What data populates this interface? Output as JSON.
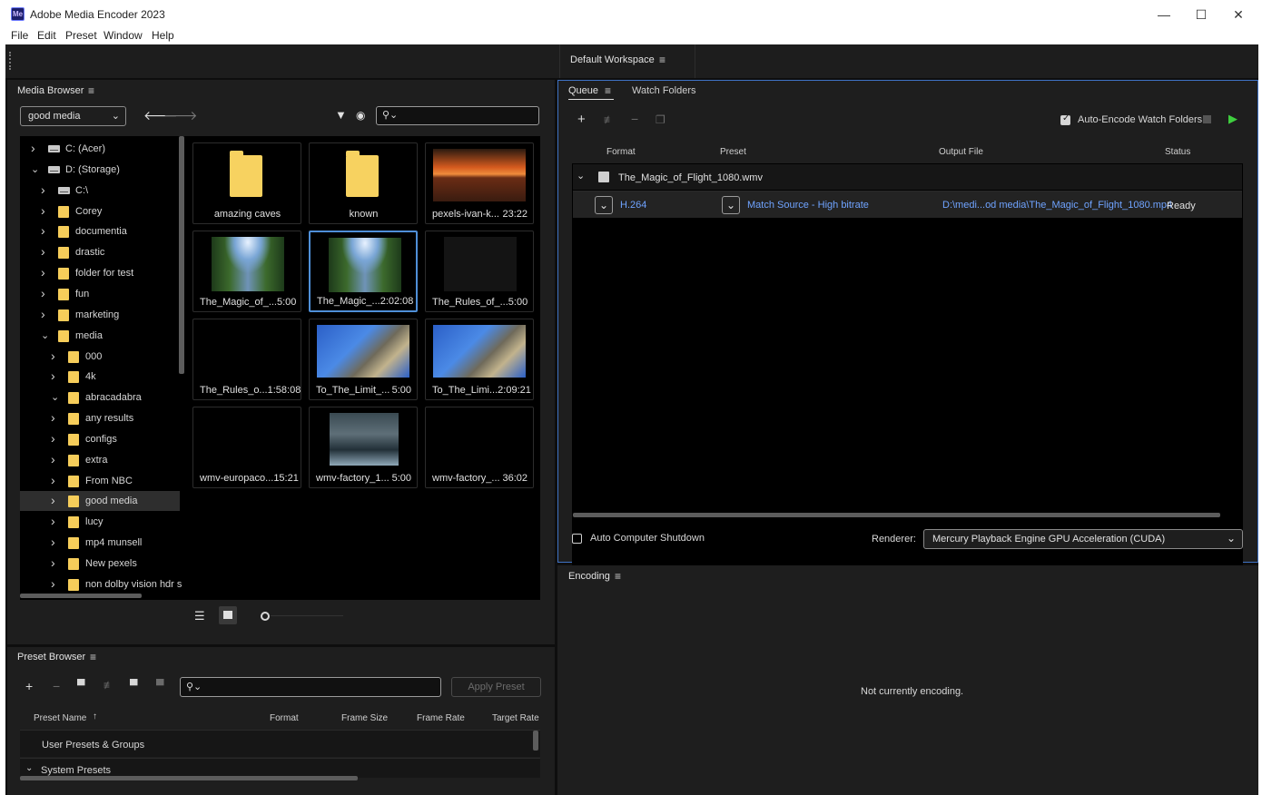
{
  "window": {
    "title": "Adobe Media Encoder 2023",
    "logo": "Me",
    "minimize": "—",
    "maximize": "☐",
    "close": "✕"
  },
  "menu": [
    "File",
    "Edit",
    "Preset",
    "Window",
    "Help"
  ],
  "workspace": {
    "label": "Default Workspace"
  },
  "media_browser": {
    "title": "Media Browser",
    "location": "good media",
    "search_placeholder": "",
    "tree": [
      {
        "label": "C: (Acer)",
        "type": "drive",
        "level": 0,
        "expanded": false
      },
      {
        "label": "D: (Storage)",
        "type": "drive",
        "level": 0,
        "expanded": true
      },
      {
        "label": "C:\\",
        "type": "drive",
        "level": 1,
        "expanded": false
      },
      {
        "label": "Corey",
        "type": "folder",
        "level": 1,
        "expanded": false
      },
      {
        "label": "documentia",
        "type": "folder",
        "level": 1,
        "expanded": false
      },
      {
        "label": "drastic",
        "type": "folder",
        "level": 1,
        "expanded": false
      },
      {
        "label": "folder for test",
        "type": "folder",
        "level": 1,
        "expanded": false
      },
      {
        "label": "fun",
        "type": "folder",
        "level": 1,
        "expanded": false
      },
      {
        "label": "marketing",
        "type": "folder",
        "level": 1,
        "expanded": false
      },
      {
        "label": "media",
        "type": "folder",
        "level": 1,
        "expanded": true
      },
      {
        "label": "000",
        "type": "folder",
        "level": 2,
        "expanded": false
      },
      {
        "label": "4k",
        "type": "folder",
        "level": 2,
        "expanded": false
      },
      {
        "label": "abracadabra",
        "type": "folder",
        "level": 2,
        "expanded": true
      },
      {
        "label": "any results",
        "type": "folder",
        "level": 2,
        "expanded": false
      },
      {
        "label": "configs",
        "type": "folder",
        "level": 2,
        "expanded": false
      },
      {
        "label": "extra",
        "type": "folder",
        "level": 2,
        "expanded": false
      },
      {
        "label": "From NBC",
        "type": "folder",
        "level": 2,
        "expanded": false
      },
      {
        "label": "good media",
        "type": "folder",
        "level": 2,
        "expanded": false,
        "selected": true
      },
      {
        "label": "lucy",
        "type": "folder",
        "level": 2,
        "expanded": false
      },
      {
        "label": "mp4 munsell",
        "type": "folder",
        "level": 2,
        "expanded": false
      },
      {
        "label": "New pexels",
        "type": "folder",
        "level": 2,
        "expanded": false
      },
      {
        "label": "non dolby vision hdr s",
        "type": "folder",
        "level": 2,
        "expanded": false
      }
    ],
    "thumbnails": [
      {
        "name": "amazing caves",
        "duration": "",
        "kind": "folder"
      },
      {
        "name": "known",
        "duration": "",
        "kind": "folder"
      },
      {
        "name": "pexels-ivan-k...",
        "duration": "23:22",
        "kind": "sunset"
      },
      {
        "name": "The_Magic_of_...",
        "duration": "5:00",
        "kind": "river"
      },
      {
        "name": "The_Magic_...",
        "duration": "2:02:08",
        "kind": "river",
        "selected": true
      },
      {
        "name": "The_Rules_of_...",
        "duration": "5:00",
        "kind": "dark"
      },
      {
        "name": "The_Rules_o...",
        "duration": "1:58:08",
        "kind": "black"
      },
      {
        "name": "To_The_Limit_...",
        "duration": "5:00",
        "kind": "sky"
      },
      {
        "name": "To_The_Limi...",
        "duration": "2:09:21",
        "kind": "sky"
      },
      {
        "name": "wmv-europaco...",
        "duration": "15:21",
        "kind": "black"
      },
      {
        "name": "wmv-factory_1...",
        "duration": "5:00",
        "kind": "factory"
      },
      {
        "name": "wmv-factory_...",
        "duration": "36:02",
        "kind": "black"
      }
    ]
  },
  "preset_browser": {
    "title": "Preset Browser",
    "apply_label": "Apply Preset",
    "columns": [
      "Preset Name",
      "Format",
      "Frame Size",
      "Frame Rate",
      "Target Rate"
    ],
    "rows": [
      "User Presets & Groups",
      "System Presets"
    ]
  },
  "queue": {
    "tabs": [
      "Queue",
      "Watch Folders"
    ],
    "auto_encode_label": "Auto-Encode Watch Folders",
    "columns": [
      "Format",
      "Preset",
      "Output File",
      "Status"
    ],
    "item": {
      "source": "The_Magic_of_Flight_1080.wmv",
      "format": "H.264",
      "preset": "Match Source - High bitrate",
      "output": "D:\\medi...od media\\The_Magic_of_Flight_1080.mp4",
      "status": "Ready"
    },
    "shutdown_label": "Auto Computer Shutdown",
    "renderer_label": "Renderer:",
    "renderer_value": "Mercury Playback Engine GPU Acceleration (CUDA)"
  },
  "encoding": {
    "title": "Encoding",
    "status": "Not currently encoding."
  },
  "colors": {
    "accent": "#4f8fd8",
    "link": "#6fa3ff",
    "play": "#3fcf3f",
    "folder": "#f6cd5a"
  }
}
